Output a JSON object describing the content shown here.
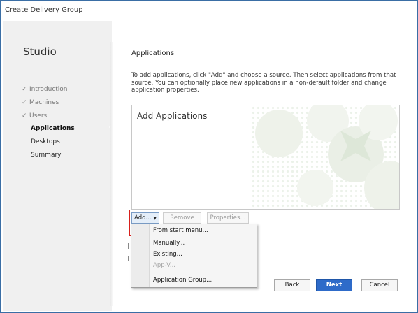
{
  "window": {
    "title": "Create Delivery Group"
  },
  "sidebar": {
    "app_title": "Studio",
    "steps": [
      {
        "label": "Introduction",
        "state": "done"
      },
      {
        "label": "Machines",
        "state": "done"
      },
      {
        "label": "Users",
        "state": "done"
      },
      {
        "label": "Applications",
        "state": "current"
      },
      {
        "label": "Desktops",
        "state": "pending"
      },
      {
        "label": "Summary",
        "state": "pending"
      }
    ]
  },
  "main": {
    "heading": "Applications",
    "instructions": "To add applications, click \"Add\" and choose a source. Then select applications from that source. You can optionally place new applications in a non-default folder and change application properties.",
    "panel_title": "Add Applications",
    "buttons": {
      "add": "Add...",
      "remove": "Remove",
      "properties": "Properties..."
    },
    "add_menu": [
      {
        "label": "From start menu...",
        "enabled": true
      },
      {
        "label": "Manually...",
        "enabled": true
      },
      {
        "label": "Existing...",
        "enabled": true
      },
      {
        "label": "App-V...",
        "enabled": false
      },
      {
        "label": "Application Group...",
        "enabled": true
      }
    ]
  },
  "footer": {
    "back": "Back",
    "next": "Next",
    "cancel": "Cancel"
  },
  "colors": {
    "accent": "#2e6bc9",
    "highlight": "#d8201c",
    "sidebar_bg": "#f0f0f0"
  },
  "icons": {
    "step_done": "checkmark-icon",
    "dropdown": "chevron-down-icon"
  }
}
